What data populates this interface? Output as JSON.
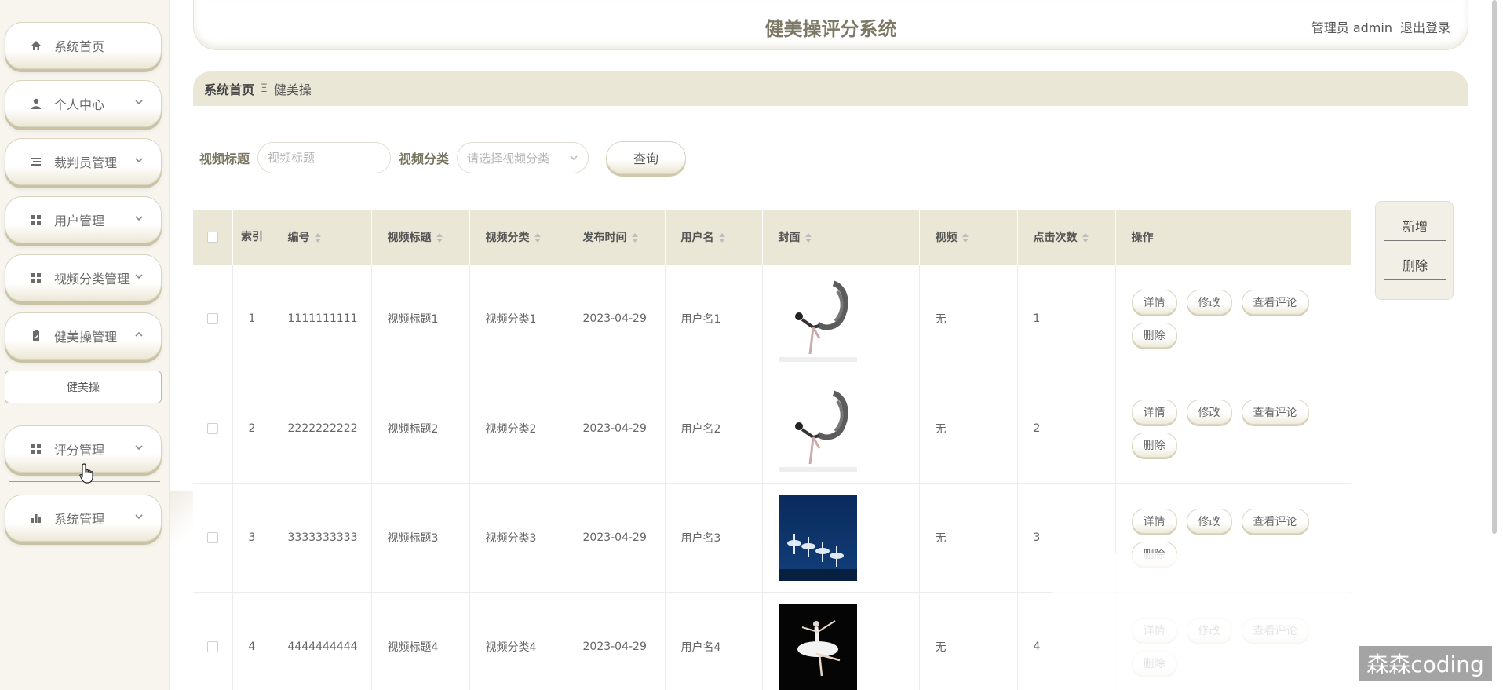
{
  "app": {
    "title": "健美操评分系统"
  },
  "header": {
    "user_label": "管理员 admin",
    "logout_label": "退出登录"
  },
  "sidebar": {
    "items": [
      {
        "label": "系统首页",
        "icon": "home-icon"
      },
      {
        "label": "个人中心",
        "icon": "user-icon"
      },
      {
        "label": "裁判员管理",
        "icon": "list-icon"
      },
      {
        "label": "用户管理",
        "icon": "grid-icon"
      },
      {
        "label": "视频分类管理",
        "icon": "grid-icon"
      },
      {
        "label": "健美操管理",
        "icon": "clipboard-icon"
      },
      {
        "label": "评分管理",
        "icon": "grid-icon"
      },
      {
        "label": "系统管理",
        "icon": "bar-chart-icon"
      }
    ],
    "submenu": {
      "label": "健美操"
    }
  },
  "breadcrumb": {
    "home": "系统首页",
    "separator": "Ξ",
    "current": "健美操"
  },
  "search": {
    "title_label": "视频标题",
    "title_placeholder": "视频标题",
    "category_label": "视频分类",
    "category_placeholder": "请选择视频分类",
    "query_label": "查询"
  },
  "actions": {
    "add_label": "新增",
    "delete_label": "删除"
  },
  "table": {
    "headers": {
      "index": "索引",
      "code": "编号",
      "video_title": "视频标题",
      "video_category": "视频分类",
      "publish_time": "发布时间",
      "username": "用户名",
      "cover": "封面",
      "video": "视频",
      "clicks": "点击次数",
      "ops": "操作"
    },
    "op_labels": {
      "detail": "详情",
      "edit": "修改",
      "comments": "查看评论",
      "delete": "删除"
    },
    "rows": [
      {
        "index": "1",
        "code": "1111111111",
        "video_title": "视频标题1",
        "video_category": "视频分类1",
        "publish_time": "2023-04-29",
        "username": "用户名1",
        "cover": "dancer-scarf",
        "video": "无",
        "clicks": "1"
      },
      {
        "index": "2",
        "code": "2222222222",
        "video_title": "视频标题2",
        "video_category": "视频分类2",
        "publish_time": "2023-04-29",
        "username": "用户名2",
        "cover": "dancer-scarf",
        "video": "无",
        "clicks": "2"
      },
      {
        "index": "3",
        "code": "3333333333",
        "video_title": "视频标题3",
        "video_category": "视频分类3",
        "publish_time": "2023-04-29",
        "username": "用户名3",
        "cover": "ballet-stage",
        "video": "无",
        "clicks": "3"
      },
      {
        "index": "4",
        "code": "4444444444",
        "video_title": "视频标题4",
        "video_category": "视频分类4",
        "publish_time": "2023-04-29",
        "username": "用户名4",
        "cover": "ballerina-tutu",
        "video": "无",
        "clicks": "4"
      }
    ]
  },
  "watermark": "森森coding",
  "colors": {
    "accent": "#ebe7d6",
    "title": "#7e7966",
    "sidebar_bg": "#f7f5ee"
  }
}
